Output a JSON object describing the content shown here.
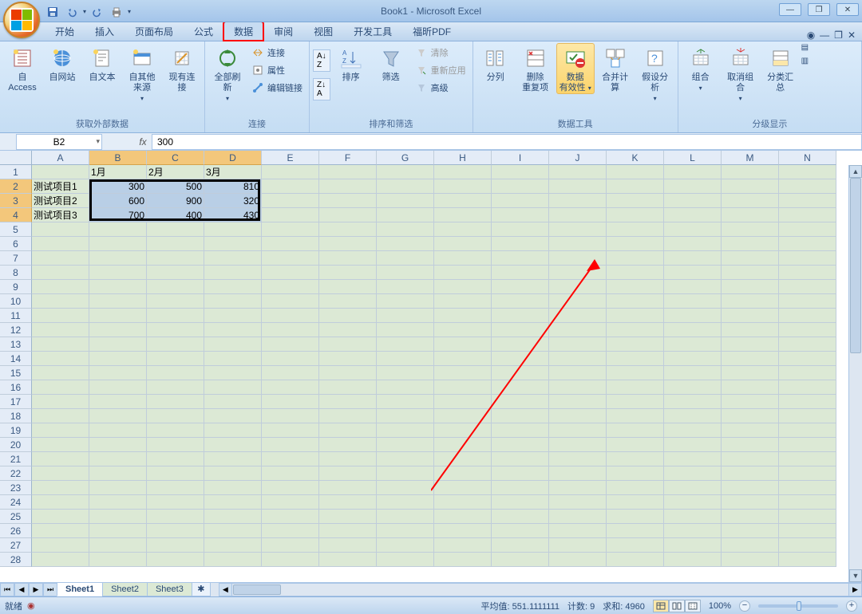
{
  "title": "Book1 - Microsoft Excel",
  "qat": {
    "save": "💾",
    "undo": "↶",
    "redo": "↷",
    "print": "🖨"
  },
  "tabs": [
    "开始",
    "插入",
    "页面布局",
    "公式",
    "数据",
    "审阅",
    "视图",
    "开发工具",
    "福昕PDF"
  ],
  "active_tab_index": 4,
  "ribbon": {
    "g1": {
      "label": "获取外部数据",
      "b1": "自 Access",
      "b2": "自网站",
      "b3": "自文本",
      "b4": "自其他来源",
      "b5": "现有连接"
    },
    "g2": {
      "label": "连接",
      "b1": "全部刷新",
      "s1": "连接",
      "s2": "属性",
      "s3": "编辑链接"
    },
    "g3": {
      "label": "排序和筛选",
      "sort": "排序",
      "filter": "筛选",
      "s1": "清除",
      "s2": "重新应用",
      "s3": "高级"
    },
    "g4": {
      "label": "数据工具",
      "b1": "分列",
      "b2": "删除\n重复项",
      "b3": "数据\n有效性",
      "b4": "合并计算",
      "b5": "假设分析"
    },
    "g5": {
      "label": "分级显示",
      "b1": "组合",
      "b2": "取消组合",
      "b3": "分类汇总"
    }
  },
  "name_box": "B2",
  "formula": "300",
  "columns": [
    "A",
    "B",
    "C",
    "D",
    "E",
    "F",
    "G",
    "H",
    "I",
    "J",
    "K",
    "L",
    "M",
    "N"
  ],
  "row_count": 28,
  "selected_cols": [
    1,
    2,
    3
  ],
  "selected_rows": [
    1,
    2,
    3
  ],
  "grid": {
    "r1": {
      "A": "",
      "B": "1月",
      "C": "2月",
      "D": "3月"
    },
    "r2": {
      "A": "测试项目1",
      "B": "300",
      "C": "500",
      "D": "810"
    },
    "r3": {
      "A": "测试项目2",
      "B": "600",
      "C": "900",
      "D": "320"
    },
    "r4": {
      "A": "测试项目3",
      "B": "700",
      "C": "400",
      "D": "430"
    }
  },
  "sheets": [
    "Sheet1",
    "Sheet2",
    "Sheet3"
  ],
  "active_sheet": 0,
  "status": {
    "ready": "就绪",
    "avg_label": "平均值: ",
    "avg": "551.1111111",
    "count_label": "计数: ",
    "count": "9",
    "sum_label": "求和: ",
    "sum": "4960",
    "zoom": "100%"
  }
}
